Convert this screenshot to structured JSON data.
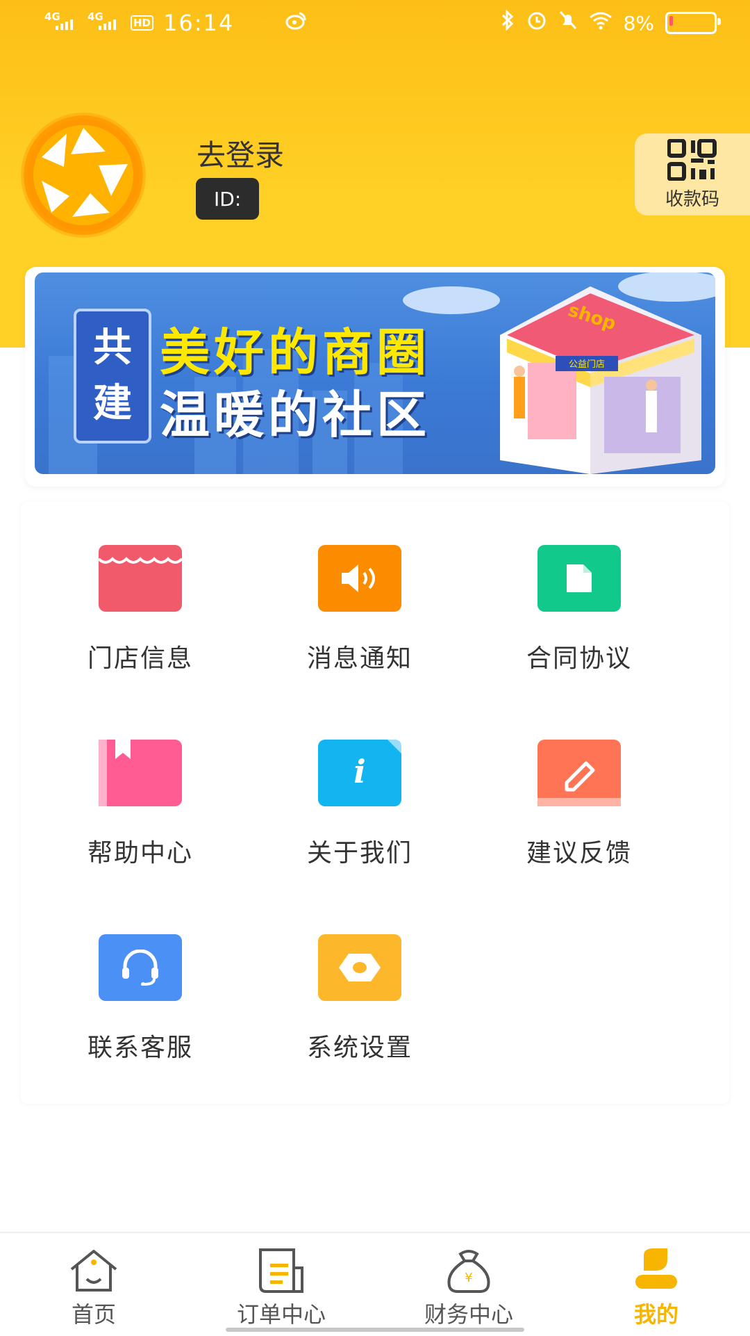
{
  "status_bar": {
    "net1": "4G",
    "net2": "4G",
    "hd": "HD",
    "time": "16:14",
    "battery_percent": "8%",
    "battery_level": 0.08
  },
  "profile": {
    "login_text": "去登录",
    "id_label": "ID:",
    "qr_label": "收款码"
  },
  "banner": {
    "badge_line1": "共",
    "badge_line2": "建",
    "title": "美好的商圈",
    "subtitle": "温暖的社区",
    "shop_sign": "shop",
    "store_sign": "公益门店"
  },
  "grid": {
    "items": [
      {
        "label": "门店信息",
        "icon": "store-icon",
        "color": "#f05a6a"
      },
      {
        "label": "消息通知",
        "icon": "speaker-icon",
        "color": "#fb8c00"
      },
      {
        "label": "合同协议",
        "icon": "document-icon",
        "color": "#12c98c"
      },
      {
        "label": "帮助中心",
        "icon": "bookmark-book-icon",
        "color": "#ff5c93"
      },
      {
        "label": "关于我们",
        "icon": "info-icon",
        "color": "#13b5f0"
      },
      {
        "label": "建议反馈",
        "icon": "pencil-icon",
        "color": "#ff7455"
      },
      {
        "label": "联系客服",
        "icon": "headset-icon",
        "color": "#4b90f5"
      },
      {
        "label": "系统设置",
        "icon": "settings-nut-icon",
        "color": "#fdb72b"
      }
    ]
  },
  "nav": {
    "items": [
      {
        "label": "首页",
        "icon": "home-icon"
      },
      {
        "label": "订单中心",
        "icon": "order-list-icon"
      },
      {
        "label": "财务中心",
        "icon": "money-bag-icon"
      },
      {
        "label": "我的",
        "icon": "user-icon",
        "active": true
      }
    ],
    "active_color": "#f7b500"
  }
}
